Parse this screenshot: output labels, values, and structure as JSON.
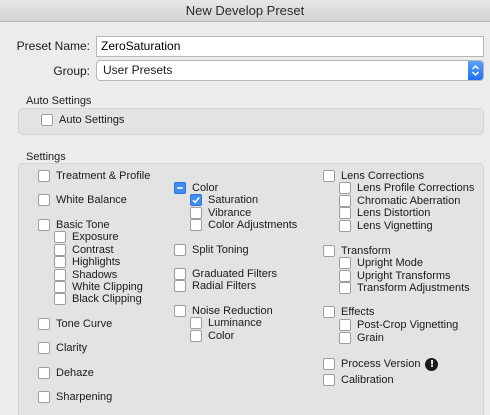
{
  "window": {
    "title": "New Develop Preset"
  },
  "form": {
    "preset_name_label": "Preset Name:",
    "preset_name_value": "ZeroSaturation",
    "group_label": "Group:",
    "group_value": "User Presets"
  },
  "auto_settings": {
    "title": "Auto Settings",
    "checkbox_label": "Auto Settings"
  },
  "settings": {
    "title": "Settings",
    "items": [
      {
        "label": "Treatment & Profile",
        "state": "unchecked"
      },
      {
        "label": "White Balance",
        "state": "unchecked"
      },
      {
        "label": "Basic Tone",
        "state": "unchecked"
      },
      {
        "label": "Exposure",
        "state": "unchecked"
      },
      {
        "label": "Contrast",
        "state": "unchecked"
      },
      {
        "label": "Highlights",
        "state": "unchecked"
      },
      {
        "label": "Shadows",
        "state": "unchecked"
      },
      {
        "label": "White Clipping",
        "state": "unchecked"
      },
      {
        "label": "Black Clipping",
        "state": "unchecked"
      },
      {
        "label": "Tone Curve",
        "state": "unchecked"
      },
      {
        "label": "Clarity",
        "state": "unchecked"
      },
      {
        "label": "Dehaze",
        "state": "unchecked"
      },
      {
        "label": "Sharpening",
        "state": "unchecked"
      },
      {
        "label": "Color",
        "state": "mixed"
      },
      {
        "label": "Saturation",
        "state": "checked"
      },
      {
        "label": "Vibrance",
        "state": "unchecked"
      },
      {
        "label": "Color Adjustments",
        "state": "unchecked"
      },
      {
        "label": "Split Toning",
        "state": "unchecked"
      },
      {
        "label": "Graduated Filters",
        "state": "unchecked"
      },
      {
        "label": "Radial Filters",
        "state": "unchecked"
      },
      {
        "label": "Noise Reduction",
        "state": "unchecked"
      },
      {
        "label": "Luminance",
        "state": "unchecked"
      },
      {
        "label": "Color",
        "state": "unchecked"
      },
      {
        "label": "Lens Corrections",
        "state": "unchecked"
      },
      {
        "label": "Lens Profile Corrections",
        "state": "unchecked"
      },
      {
        "label": "Chromatic Aberration",
        "state": "unchecked"
      },
      {
        "label": "Lens Distortion",
        "state": "unchecked"
      },
      {
        "label": "Lens Vignetting",
        "state": "unchecked"
      },
      {
        "label": "Transform",
        "state": "unchecked"
      },
      {
        "label": "Upright Mode",
        "state": "unchecked"
      },
      {
        "label": "Upright Transforms",
        "state": "unchecked"
      },
      {
        "label": "Transform Adjustments",
        "state": "unchecked"
      },
      {
        "label": "Effects",
        "state": "unchecked"
      },
      {
        "label": "Post-Crop Vignetting",
        "state": "unchecked"
      },
      {
        "label": "Grain",
        "state": "unchecked"
      },
      {
        "label": "Process Version",
        "state": "unchecked",
        "warning_icon": "exclamation-circle-icon"
      },
      {
        "label": "Calibration",
        "state": "unchecked"
      }
    ]
  },
  "colors": {
    "accent": "#3d8df5",
    "panel": "#e3e3e3",
    "background": "#ececec"
  }
}
